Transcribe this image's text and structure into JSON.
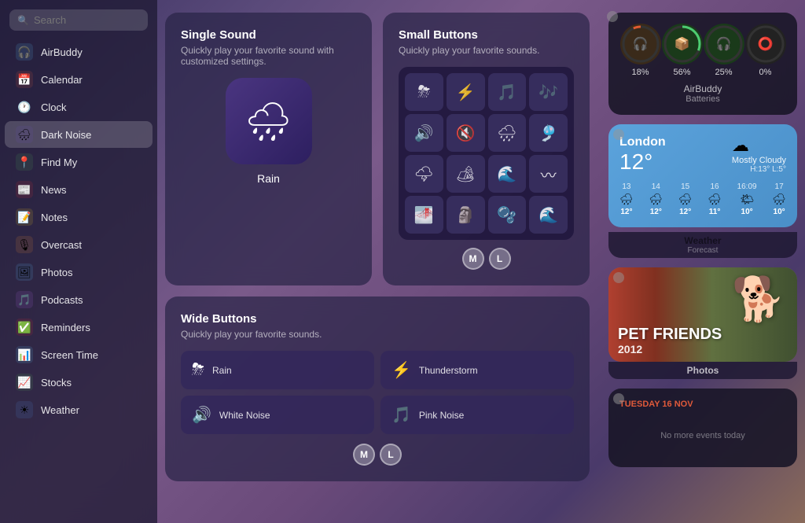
{
  "sidebar": {
    "search_placeholder": "Search",
    "items": [
      {
        "label": "AirBuddy",
        "icon": "🎧",
        "color": "#5bc4f5",
        "active": false
      },
      {
        "label": "Calendar",
        "icon": "📅",
        "color": "#e05a3a",
        "active": false
      },
      {
        "label": "Clock",
        "icon": "🕐",
        "color": "#aaa",
        "active": false
      },
      {
        "label": "Dark Noise",
        "icon": "🌧",
        "color": "#6655bb",
        "active": true
      },
      {
        "label": "Find My",
        "icon": "📍",
        "color": "#4caf50",
        "active": false
      },
      {
        "label": "News",
        "icon": "📰",
        "color": "#e03030",
        "active": false
      },
      {
        "label": "Notes",
        "icon": "📝",
        "color": "#f5d020",
        "active": false
      },
      {
        "label": "Overcast",
        "icon": "🎙",
        "color": "#f09030",
        "active": false
      },
      {
        "label": "Photos",
        "icon": "🖼",
        "color": "#5bc4f5",
        "active": false
      },
      {
        "label": "Podcasts",
        "icon": "🎵",
        "color": "#b060e0",
        "active": false
      },
      {
        "label": "Reminders",
        "icon": "✅",
        "color": "#e03030",
        "active": false
      },
      {
        "label": "Screen Time",
        "icon": "📊",
        "color": "#5bc4f5",
        "active": false
      },
      {
        "label": "Stocks",
        "icon": "📈",
        "color": "#4caf50",
        "active": false
      },
      {
        "label": "Weather",
        "icon": "☀",
        "color": "#4a90d9",
        "active": false
      }
    ]
  },
  "single_sound": {
    "title": "Single Sound",
    "subtitle": "Quickly play your favorite sound with customized settings.",
    "sound_label": "Rain",
    "sound_icon": "🌧"
  },
  "small_buttons": {
    "title": "Small Buttons",
    "subtitle": "Quickly play your favorite sounds.",
    "buttons": [
      "⛈",
      "⚡",
      "🎵",
      "🎶",
      "🔊",
      "🔇",
      "🌧",
      "🎐",
      "🌩",
      "🏕",
      "🌊",
      "〰",
      "🌁",
      "🗿",
      "🫧",
      "🌊"
    ],
    "avatars": [
      "M",
      "L"
    ]
  },
  "wide_buttons": {
    "title": "Wide Buttons",
    "subtitle": "Quickly play your favorite sounds.",
    "buttons": [
      {
        "icon": "⛈",
        "label": "Rain"
      },
      {
        "icon": "⚡",
        "label": "Thunderstorm"
      },
      {
        "icon": "🔊",
        "label": "White Noise"
      },
      {
        "icon": "🎵",
        "label": "Pink Noise"
      }
    ],
    "avatars": [
      "M",
      "L"
    ]
  },
  "airbuddy": {
    "title": "AirBuddy",
    "subtitle": "Batteries",
    "circles": [
      {
        "icon": "🎧",
        "pct": 18,
        "color": "#e05a30",
        "bg": "#3a2a1a"
      },
      {
        "icon": "📦",
        "pct": 56,
        "color": "#4ccc70",
        "bg": "#1a3a1a"
      },
      {
        "icon": "🎧",
        "pct": 25,
        "color": "#4ccc70",
        "bg": "#1a3a1a"
      },
      {
        "icon": "⭕",
        "pct": 0,
        "color": "#444",
        "bg": "#222"
      }
    ]
  },
  "weather": {
    "city": "London",
    "temp": "12°",
    "description": "Mostly Cloudy",
    "high": "H:13°",
    "low": "L:5°",
    "forecast": [
      {
        "day": "13",
        "icon": "🌧",
        "temp": "12°"
      },
      {
        "day": "14",
        "icon": "🌧",
        "temp": "12°"
      },
      {
        "day": "15",
        "icon": "🌧",
        "temp": "12°"
      },
      {
        "day": "16",
        "icon": "🌧",
        "temp": "11°"
      },
      {
        "day": "16:09",
        "icon": "🌤",
        "temp": "10°"
      },
      {
        "day": "17",
        "icon": "🌧",
        "temp": "10°"
      }
    ],
    "footer_title": "Weather",
    "footer_sub": "Forecast"
  },
  "photos": {
    "pet_friends": "PET FRIENDS",
    "year": "2012",
    "footer_label": "Photos"
  },
  "calendar": {
    "date_label": "TUESDAY 16 NOV",
    "no_events": "No more events today"
  }
}
